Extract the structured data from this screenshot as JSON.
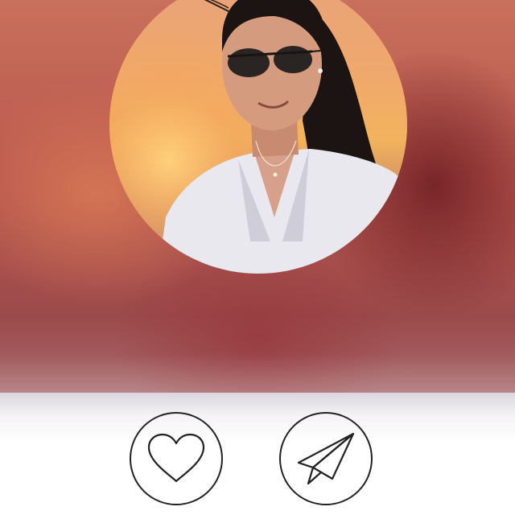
{
  "profile": {
    "avatar_icon": "person-photo"
  },
  "actions": {
    "like_icon": "heart-icon",
    "send_icon": "paper-plane-icon"
  },
  "colors": {
    "blur_dark": "#9c4a4b",
    "blur_light": "#c9705c",
    "button_stroke": "#222222",
    "panel_bg": "#ffffff"
  }
}
